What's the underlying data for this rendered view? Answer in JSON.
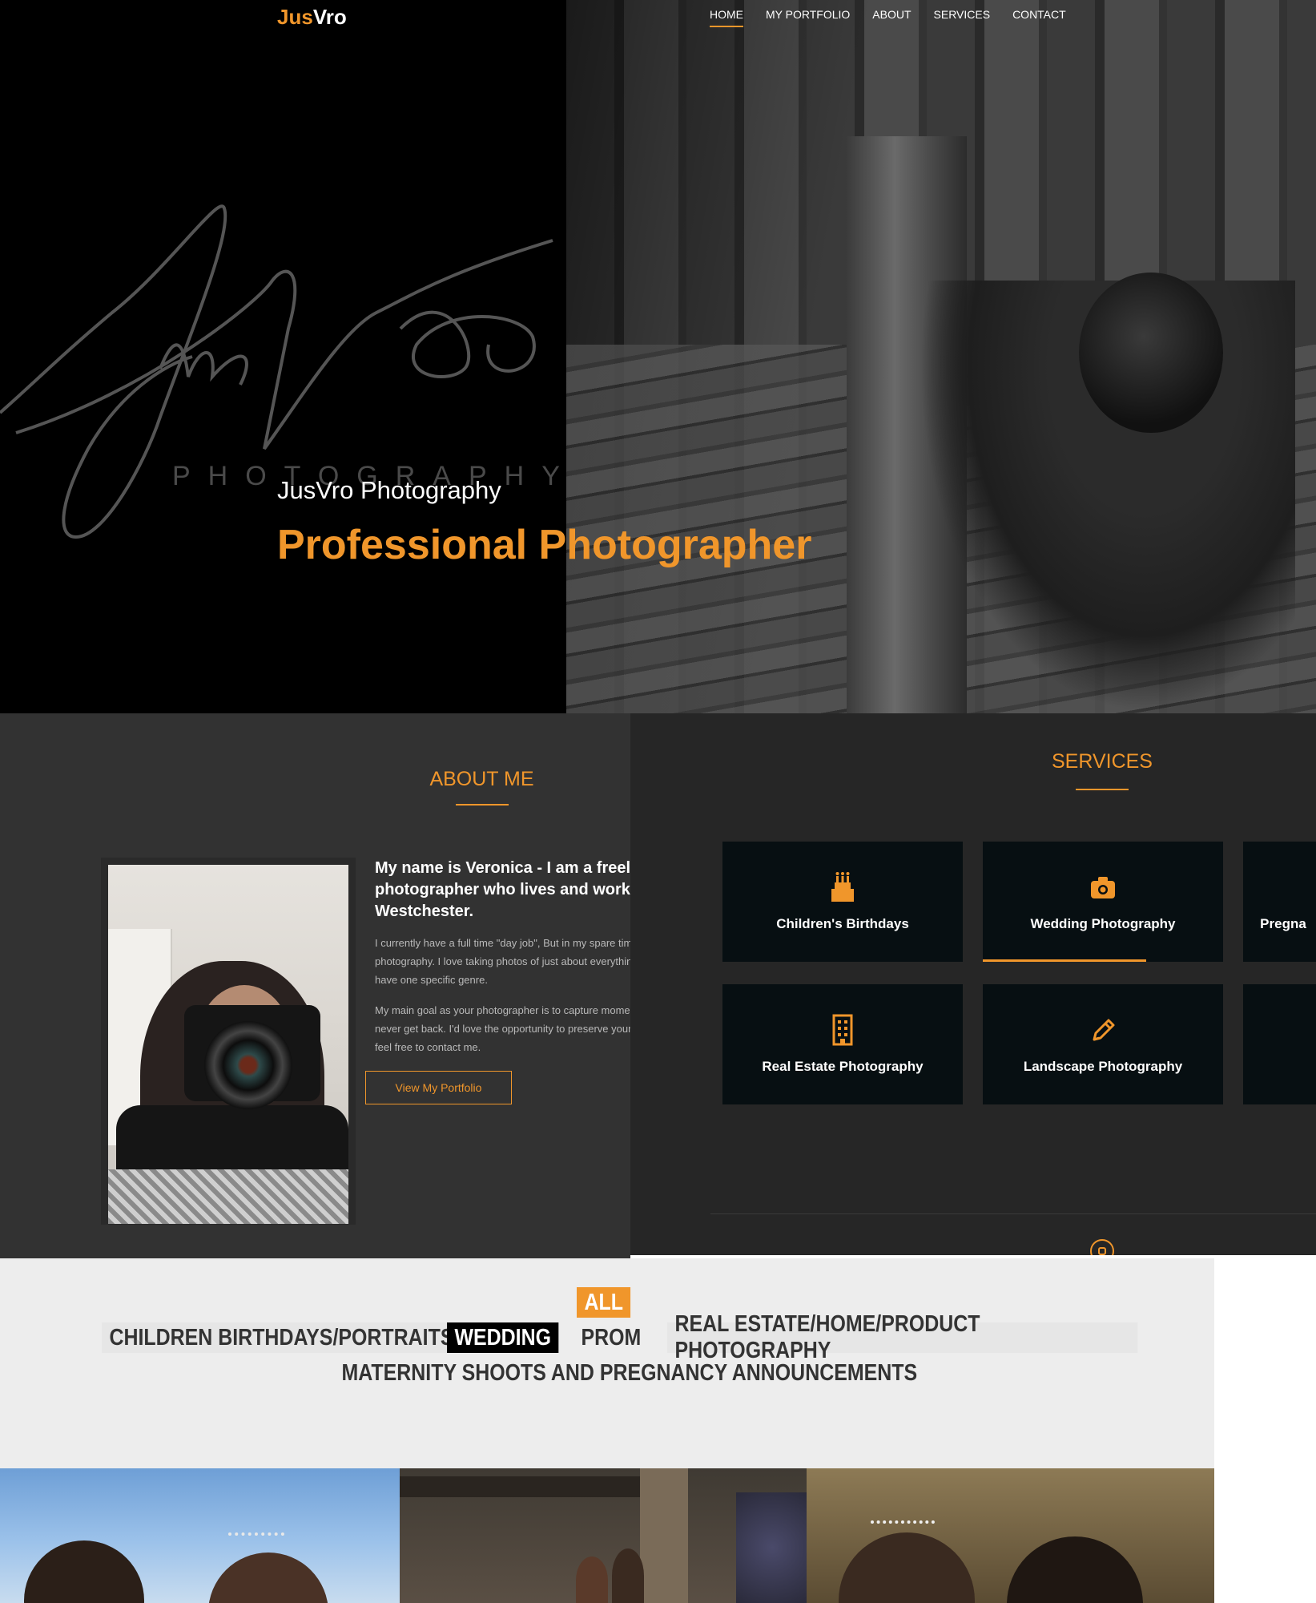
{
  "brand": {
    "logo_left": "Jus",
    "logo_right": "Vro",
    "accent": "#f0962b"
  },
  "nav": {
    "items": [
      {
        "label": "HOME",
        "active": true
      },
      {
        "label": "MY PORTFOLIO"
      },
      {
        "label": "ABOUT"
      },
      {
        "label": "SERVICES"
      },
      {
        "label": "CONTACT"
      }
    ]
  },
  "hero": {
    "script_logo": "JusVro",
    "script_logo_sub": "PHOTOGRAPHY",
    "subtitle": "JusVro Photography",
    "title": "Professional Photographer"
  },
  "about": {
    "heading": "ABOUT ME",
    "intro": "My name is Veronica - I am a freelance photographer who lives and works out of Westchester.",
    "p1": "I currently have a full time \"day job\", But in my spare time I enjoy photography. I love taking photos of just about everything, I don't have one specific genre.",
    "p2": "My main goal as your photographer is to capture moments you will never get back. I'd love the opportunity to preserve your memories, feel free to contact me.",
    "button": "View My Portfolio"
  },
  "services": {
    "heading": "SERVICES",
    "cards": [
      {
        "label": "Children's Birthdays",
        "icon": "birthday-cake-icon"
      },
      {
        "label": "Wedding Photography",
        "icon": "camera-icon"
      },
      {
        "label": "Pregna",
        "icon": ""
      },
      {
        "label": "Real Estate Photography",
        "icon": "building-icon"
      },
      {
        "label": "Landscape Photography",
        "icon": "pencil-icon"
      },
      {
        "label": "",
        "icon": ""
      }
    ],
    "social_icon": "instagram-icon"
  },
  "filters": {
    "all": "ALL",
    "items": [
      "CHILDREN BIRTHDAYS/PORTRAITS",
      "WEDDING",
      "PROM",
      "REAL ESTATE/HOME/PRODUCT PHOTOGRAPHY",
      "MATERNITY SHOOTS AND PREGNANCY ANNOUNCEMENTS"
    ]
  }
}
